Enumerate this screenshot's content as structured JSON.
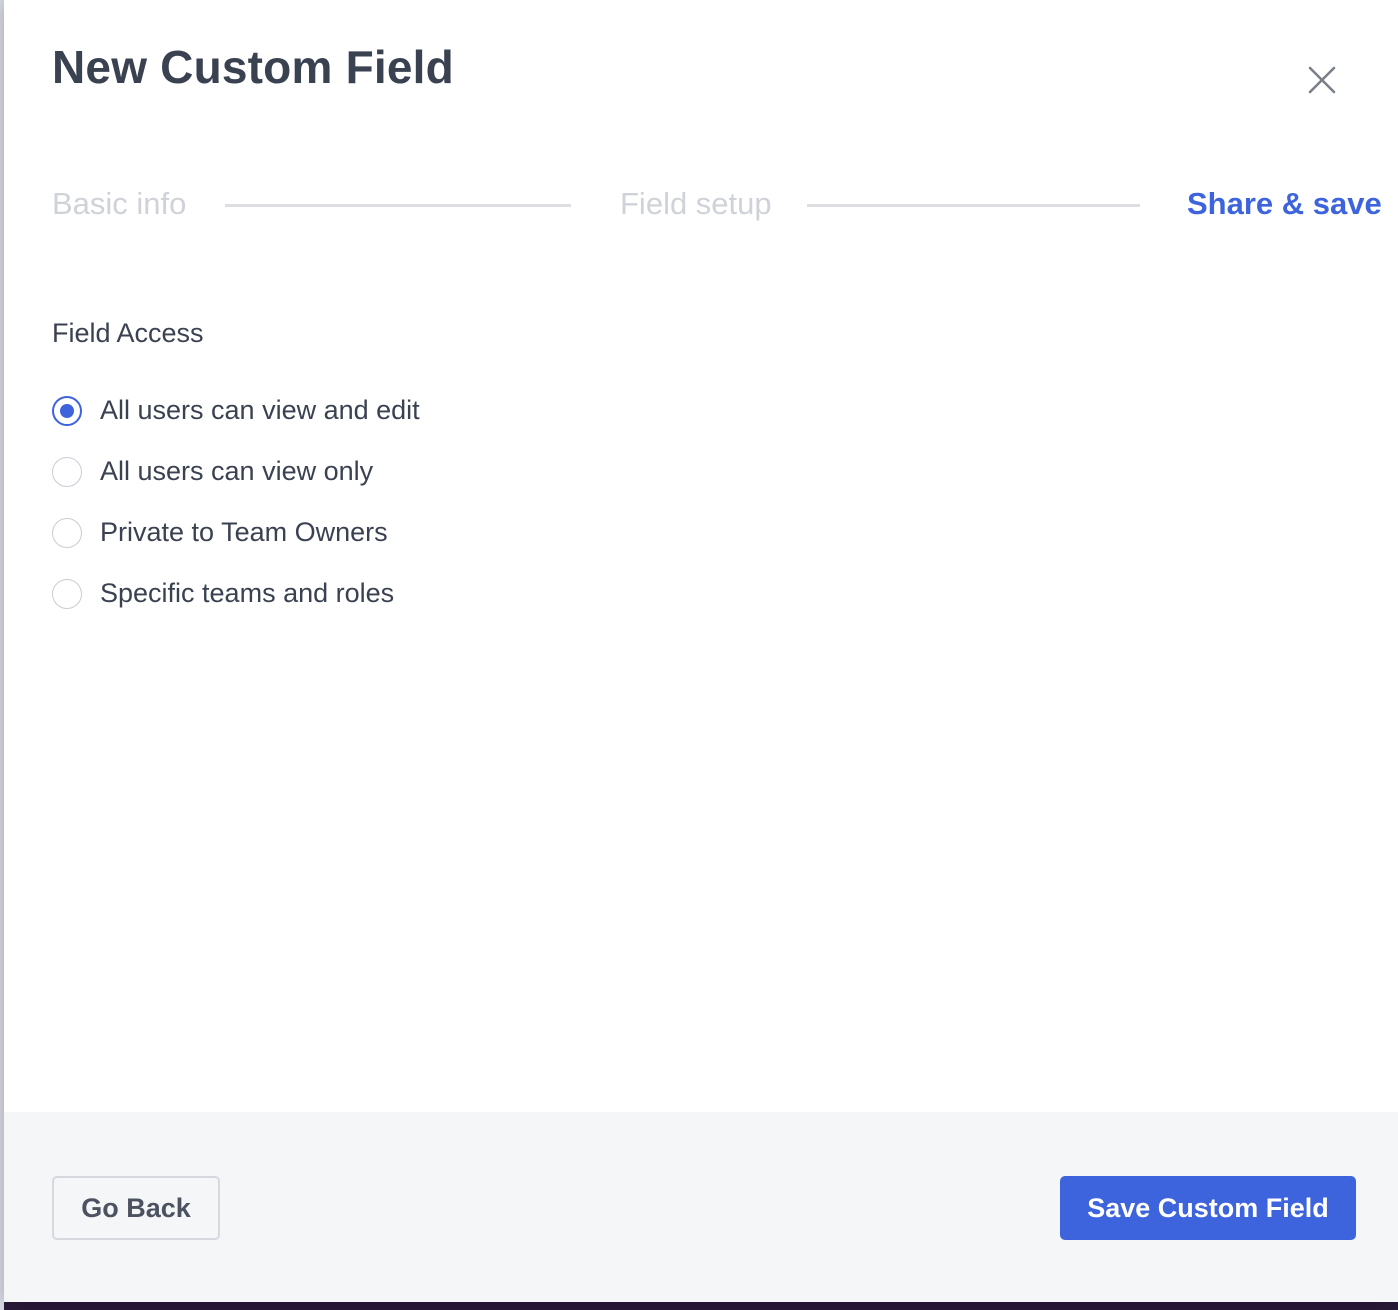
{
  "modal": {
    "title": "New Custom Field",
    "close_icon": "close-icon"
  },
  "stepper": {
    "steps": [
      {
        "label": "Basic info",
        "state": "inactive"
      },
      {
        "label": "Field setup",
        "state": "inactive"
      },
      {
        "label": "Share & save",
        "state": "active"
      }
    ]
  },
  "field_access": {
    "label": "Field Access",
    "selected_index": 0,
    "options": [
      {
        "label": "All users can view and edit",
        "checked": true
      },
      {
        "label": "All users can view only",
        "checked": false
      },
      {
        "label": "Private to Team Owners",
        "checked": false
      },
      {
        "label": "Specific teams and roles",
        "checked": false
      }
    ]
  },
  "footer": {
    "back_label": "Go Back",
    "save_label": "Save Custom Field"
  },
  "colors": {
    "accent": "#3d63dd",
    "title_text": "#3a4150",
    "inactive_step": "#cfd2d8",
    "footer_bg": "#f5f6f8"
  }
}
